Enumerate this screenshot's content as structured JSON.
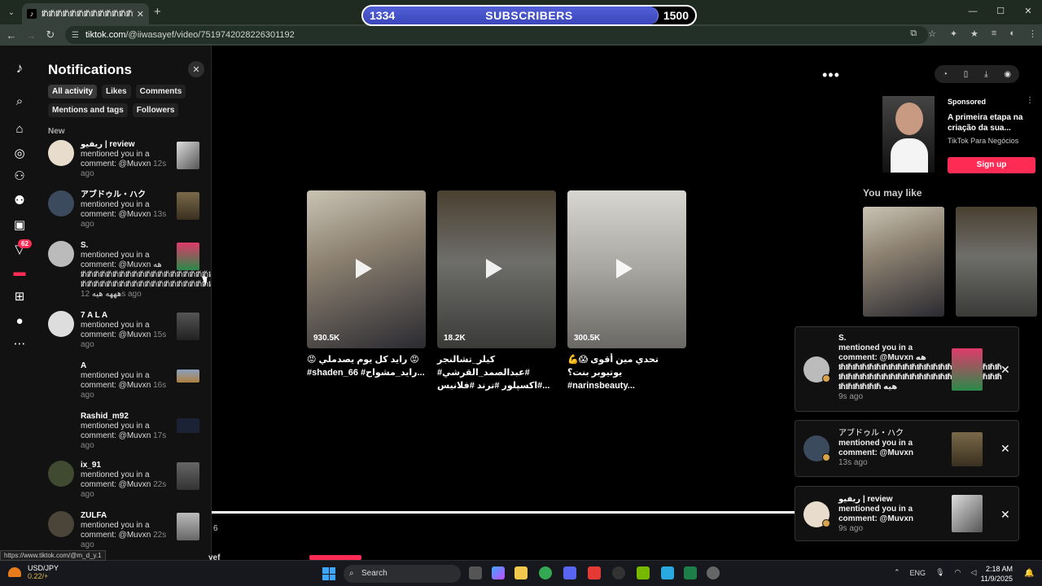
{
  "browser": {
    "tab": {
      "title": "ᵺᵺᵺᵺᵺᵺᵺᵺᵺᵺᵺᵺᵺᵺᵺᵺᵺᵺᵺ(62)",
      "close": "✕"
    },
    "new_tab": "+",
    "window": {
      "minimize": "—",
      "maximize": "☐",
      "close": "✕"
    },
    "url_host": "tiktok.com",
    "url_path": "/@iiwasayef/video/7519742028226301192"
  },
  "subscriber_goal": {
    "current": 1334,
    "goal": 1500,
    "label": "SUBSCRIBERS",
    "current_text": "1334",
    "goal_text": "1500"
  },
  "sidebar": {
    "notification_badge": "62"
  },
  "notifications": {
    "title": "Notifications",
    "close": "✕",
    "filters": [
      "All activity",
      "Likes",
      "Comments",
      "Mentions and tags",
      "Followers"
    ],
    "section": "New",
    "items": [
      {
        "user": "ريفيو | review",
        "text": "mentioned you in a comment: @Muvxn",
        "time": "12s ago"
      },
      {
        "user": "アブドゥル・ハク",
        "text": "mentioned you in a comment: @Muvxn",
        "time": "13s ago"
      },
      {
        "user": "S.",
        "text": "mentioned you in a comment: @Muvxn هه ᵺᵺᵺᵺᵺᵺᵺᵺᵺᵺᵺᵺᵺᵺᵺᵺᵺᵺᵺᵺᵺᵺ ᵺᵺᵺᵺᵺᵺᵺᵺᵺᵺᵺᵺᵺᵺᵺᵺᵺᵺᵺᵺᵺᵺ هههه هيه",
        "time": "12s ago"
      },
      {
        "user": "7 A L A",
        "text": "mentioned you in a comment: @Muvxn",
        "time": "15s ago"
      },
      {
        "user": "A",
        "text": "mentioned you in a comment: @Muvxn",
        "time": "16s ago"
      },
      {
        "user": "Rashid_m92",
        "text": "mentioned you in a comment: @Muvxn",
        "time": "17s ago"
      },
      {
        "user": "ix_91",
        "text": "mentioned you in a comment: @Muvxn",
        "time": "22s ago"
      },
      {
        "user": "ZULFA",
        "text": "mentioned you in a comment: @Muvxn",
        "time": "22s ago"
      }
    ]
  },
  "main": {
    "more": "•••",
    "videos": [
      {
        "views": "930.5K",
        "caption": "😡 رايد كل يوم يصدملي 😡 #shaden_66 #رايد_مشواح..."
      },
      {
        "views": "18.2K",
        "caption": "كيلر_تشالنجر #عبدالصمد_القرشي# #اكسپلور #ترند #فلانيس..."
      },
      {
        "views": "300.5K",
        "caption": "💪😱 تحدي مين أقوى يوتيوبر بنت؟ #narinsbeauty..."
      }
    ],
    "progress_count": "6",
    "bottom_name": "yef"
  },
  "right": {
    "sponsored": "Sponsored",
    "ad_title": "A primeira etapa na criação da sua...",
    "ad_brand": "TikTok Para Negócios",
    "ad_cta": "Sign up",
    "ad_more": "⋮",
    "you_may_like": "You may like"
  },
  "toasts": [
    {
      "user": "S.",
      "text": "mentioned you in a comment: @Muvxn هه ᵺᵺᵺᵺᵺᵺᵺᵺᵺᵺᵺᵺᵺᵺᵺᵺᵺᵺᵺᵺᵺᵺᵺ ᵺᵺᵺᵺᵺᵺᵺᵺᵺᵺᵺᵺᵺᵺᵺᵺᵺᵺᵺᵺᵺᵺᵺ ᵺᵺᵺᵺᵺᵺ هيه",
      "time": "9s ago"
    },
    {
      "user": "アブドゥル・ハク",
      "text": "mentioned you in a comment: @Muvxn",
      "time": "13s ago"
    },
    {
      "user": "ريفيو | review",
      "text": "mentioned you in a comment: @Muvxn",
      "time": "9s ago"
    }
  ],
  "status_link": "https://www.tiktok.com/@m_d_y.1",
  "taskbar": {
    "weather_name": "USD/JPY",
    "weather_value": "0.22/+",
    "search": "Search",
    "lang": "ENG",
    "time": "2:18 AM",
    "date": "11/9/2025"
  }
}
